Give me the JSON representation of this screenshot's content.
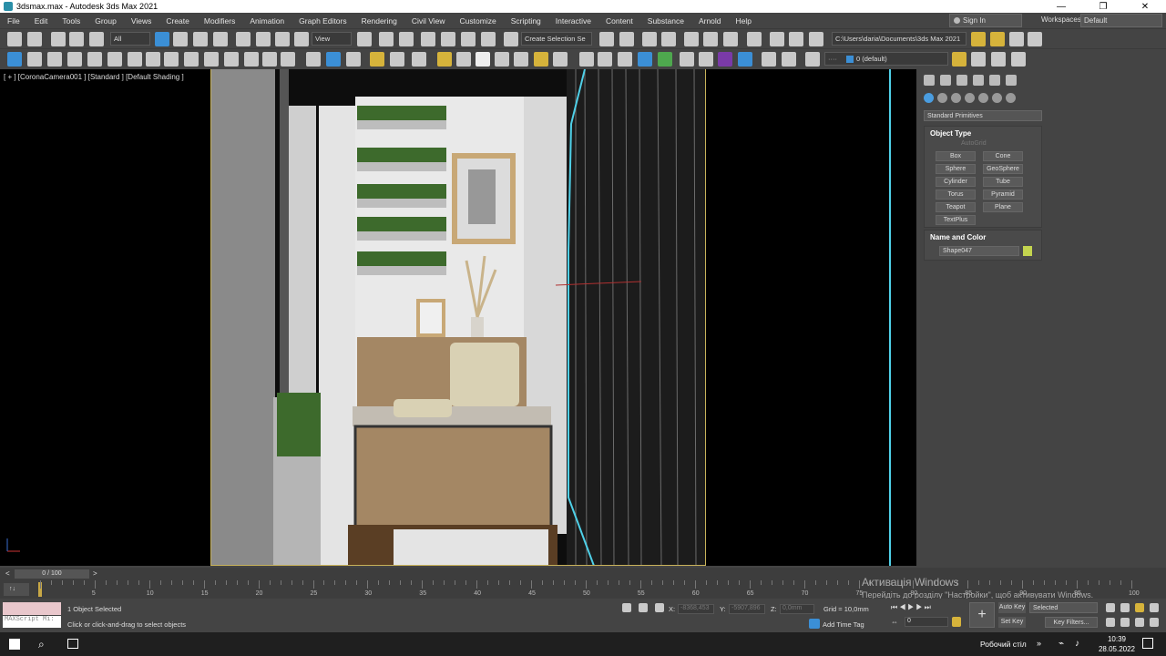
{
  "window": {
    "title": "3dsmax.max - Autodesk 3ds Max 2021",
    "buttons": [
      "—",
      "❐",
      "✕"
    ]
  },
  "menu": {
    "items": [
      "File",
      "Edit",
      "Tools",
      "Group",
      "Views",
      "Create",
      "Modifiers",
      "Animation",
      "Graph Editors",
      "Rendering",
      "Civil View",
      "Customize",
      "Scripting",
      "Interactive",
      "Content",
      "Substance",
      "Arnold",
      "Help"
    ],
    "sign_in": "Sign In",
    "workspaces_label": "Workspaces:",
    "workspaces_value": "Default"
  },
  "toolbar": {
    "filter": "All",
    "view": "View",
    "selection_set": "Create Selection Se",
    "path": "C:\\Users\\daria\\Documents\\3ds Max 2021",
    "layer": "0 (default)"
  },
  "viewport": {
    "label": "[ + ] [CoronaCamera001 ] [Standard ] [Default Shading ]"
  },
  "command_panel": {
    "dropdown": "Standard Primitives",
    "object_type_title": "Object Type",
    "autogrid": "AutoGrid",
    "primitives": [
      "Box",
      "Cone",
      "Sphere",
      "GeoSphere",
      "Cylinder",
      "Tube",
      "Torus",
      "Pyramid",
      "Teapot",
      "Plane",
      "TextPlus"
    ],
    "name_color_title": "Name and Color",
    "object_name": "Shape047",
    "object_color": "#c3d44f"
  },
  "timeline": {
    "frame": "0 / 100",
    "ticks": [
      "5",
      "10",
      "15",
      "20",
      "25",
      "30",
      "35",
      "40",
      "45",
      "50",
      "55",
      "60",
      "65",
      "70",
      "75",
      "80",
      "85",
      "90",
      "95",
      "100"
    ],
    "frame_start": "0"
  },
  "status": {
    "selected": "1 Object Selected",
    "prompt": "Click or click-and-drag to select objects",
    "maxscript": "MAXScript Mi:",
    "x_label": "X:",
    "x_value": "-8368,453",
    "y_label": "Y:",
    "y_value": "-5907,896",
    "z_label": "Z:",
    "z_value": "0,0mm",
    "grid": "Grid = 10,0mm",
    "add_time_tag": "Add Time Tag",
    "auto_key": "Auto Key",
    "set_key": "Set Key",
    "selected_dd": "Selected",
    "key_filters": "Key Filters...",
    "frame_value": "0"
  },
  "watermark": {
    "line1": "Активація Windows",
    "line2": "Перейдіть до розділу \"Настройки\", щоб активувати Windows."
  },
  "taskbar": {
    "desktop": "Робочий стіл",
    "time": "10:39",
    "date": "28.05.2022"
  }
}
